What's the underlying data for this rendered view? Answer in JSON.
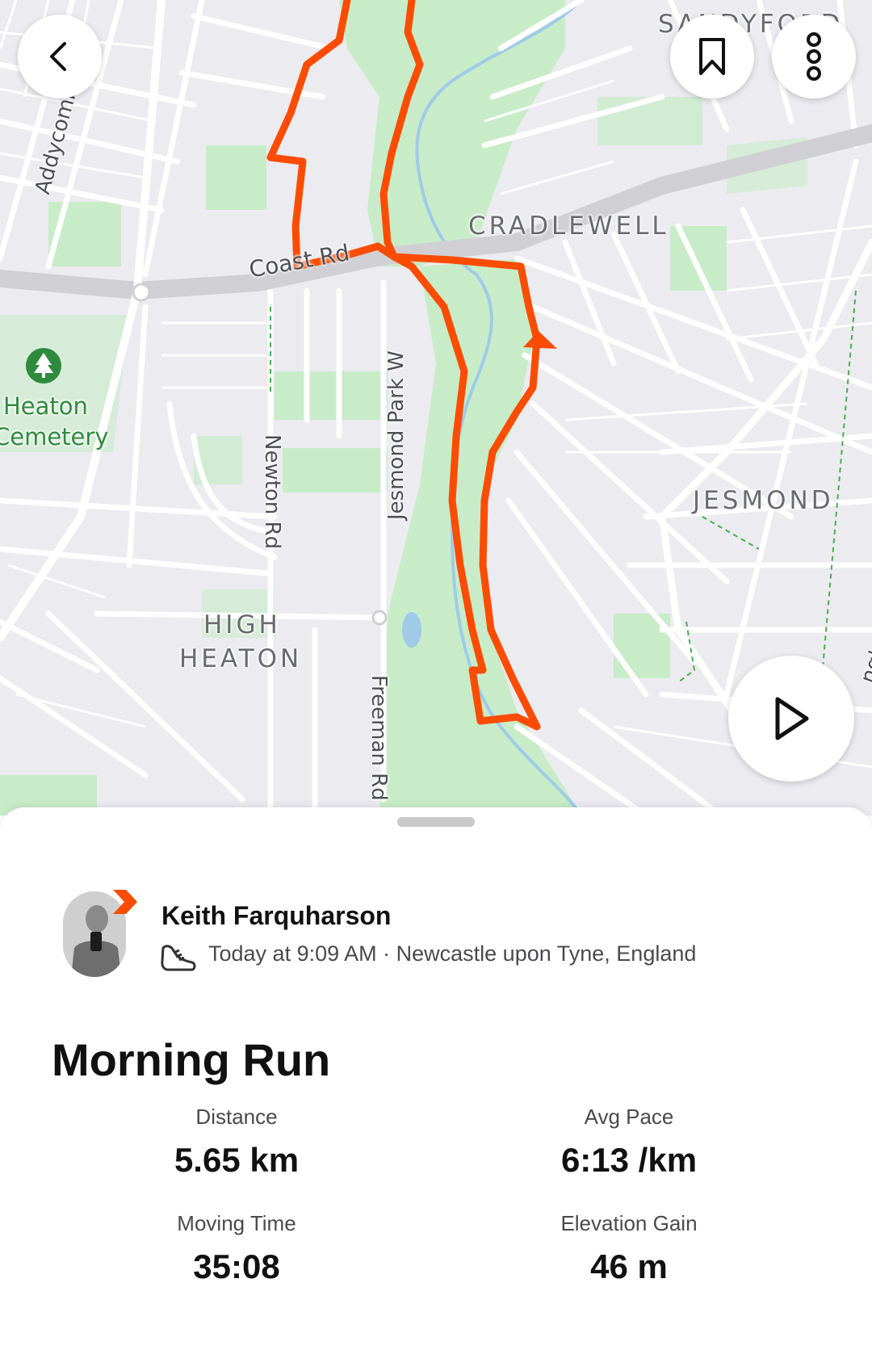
{
  "map": {
    "labels": {
      "sandyford": "SANDYFORD",
      "cradlewell": "CRADLEWELL",
      "jesmond": "JESMOND",
      "high": "HIGH",
      "heaton": "HEATON",
      "heaton_cemetery_1": "Heaton",
      "heaton_cemetery_2": "Cemetery",
      "coast_rd": "Coast Rd",
      "addycombe": "Addycombe Ter",
      "jesmond_park_w": "Jesmond Park W",
      "newton_rd": "Newton Rd",
      "freeman_rd": "Freeman Rd",
      "right_edge": "ngh"
    },
    "colors": {
      "route": "#fc4c02",
      "park": "#c8ecc8",
      "road": "#ffffff",
      "major_road": "#d0d0d4",
      "water": "#9fcbe8"
    }
  },
  "buttons": {
    "back": "back-icon",
    "save": "bookmark-icon",
    "more": "more-vertical-icon",
    "play": "play-icon"
  },
  "activity": {
    "athlete": "Keith Farquharson",
    "meta": "Today at 9:09 AM · Newcastle upon Tyne, England",
    "title": "Morning Run",
    "stats": [
      {
        "label": "Distance",
        "value": "5.65 km"
      },
      {
        "label": "Avg Pace",
        "value": "6:13 /km"
      },
      {
        "label": "Moving Time",
        "value": "35:08"
      },
      {
        "label": "Elevation Gain",
        "value": "46 m"
      }
    ]
  }
}
